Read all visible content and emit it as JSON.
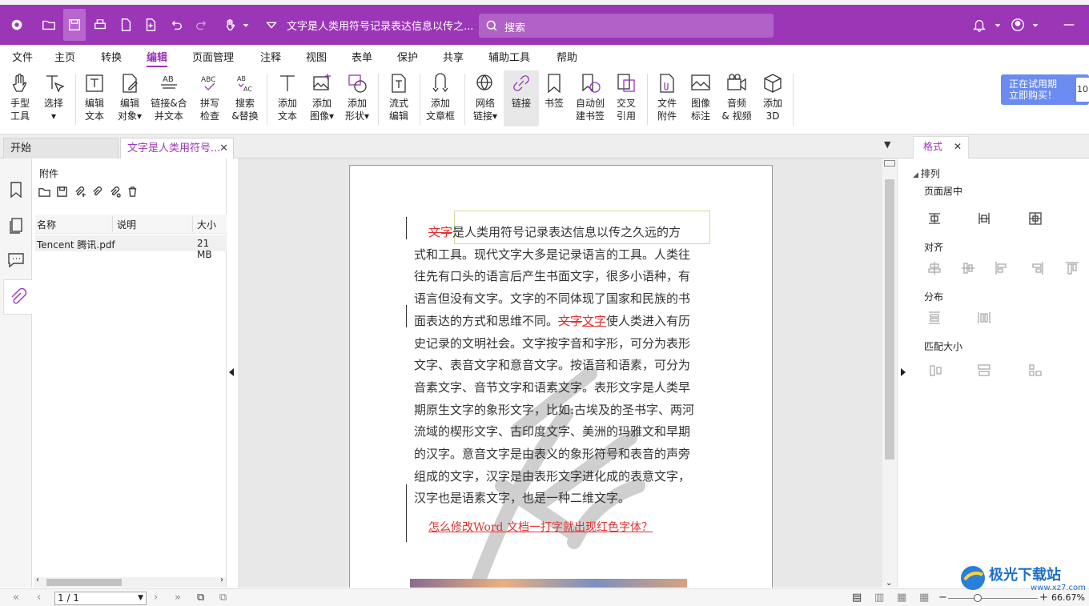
{
  "app": {
    "document_title": "文字是人类用符号记录表达信息以传之...",
    "search_placeholder": "搜索"
  },
  "menu": [
    "文件",
    "主页",
    "转换",
    "编辑",
    "页面管理",
    "注释",
    "视图",
    "表单",
    "保护",
    "共享",
    "辅助工具",
    "帮助"
  ],
  "ribbon": {
    "hand": [
      "手型",
      "工具"
    ],
    "select": [
      "选择",
      ""
    ],
    "edit_text": [
      "编辑",
      "文本"
    ],
    "edit_object": [
      "编辑",
      "对象"
    ],
    "link_merge": [
      "链接&合",
      "并文本"
    ],
    "spell": [
      "拼写",
      "检查"
    ],
    "search_replace": [
      "搜索",
      "&替换"
    ],
    "add_text": [
      "添加",
      "文本"
    ],
    "add_image": [
      "添加",
      "图像"
    ],
    "add_shape": [
      "添加",
      "形状"
    ],
    "flow_edit": [
      "流式",
      "编辑"
    ],
    "add_textbox": [
      "添加",
      "文章框"
    ],
    "web_link": [
      "网络",
      "链接"
    ],
    "link": [
      "链接",
      ""
    ],
    "bookmark": [
      "书签",
      ""
    ],
    "auto_bookmark": [
      "自动创",
      "建书签"
    ],
    "cross_ref": [
      "交叉",
      "引用"
    ],
    "file_attach": [
      "文件",
      "附件"
    ],
    "image_mark": [
      "图像",
      "标注"
    ],
    "audio_video": [
      "音频",
      "& 视频"
    ],
    "add_3d": [
      "添加",
      "3D"
    ],
    "trial": [
      "正在试用期",
      "立即购买！"
    ],
    "trial_side": "10"
  },
  "tabs": {
    "start": "开始",
    "doc": "文字是人类用符号...",
    "format": "格式"
  },
  "attachments": {
    "title": "附件",
    "columns": [
      "名称",
      "说明",
      "大小"
    ],
    "rows": [
      {
        "name": "Tencent 腾讯.pdf",
        "desc": "",
        "size": "21 MB"
      }
    ]
  },
  "document": {
    "lines": [
      "文字是人类用符号记录表达信息以传之久远的方",
      "式和工具。现代文字大多是记录语言的工具。人类往",
      "往先有口头的语言后产生书面文字，很多小语种，有",
      "语言但没有文字。文字的不同体现了国家和民族的书",
      "面表达的方式和思维不同。文字文字使人类进入有历",
      "史记录的文明社会。文字按字音和字形，可分为表形",
      "文字、表音文字和意音文字。按语音和语素，可分为",
      "音素文字、音节文字和语素文字。表形文字是人类早",
      "期原生文字的象形文字，比如:古埃及的圣书字、两河",
      "流域的楔形文字、古印度文字、美洲的玛雅文和早期",
      "的汉字。意音文字是由表义的象形符号和表音的声旁",
      "组成的文字，汉字是由表形文字进化成的表意文字，",
      "汉字也是语素文字，也是一种二维文字。"
    ],
    "strike_first": "文字",
    "first_rest": "是人类用符号记录表达信息以传之久远的方",
    "line5_pre": "面表达的方式和思维不同。",
    "line5_strike": "文字",
    "line5_under": "文字",
    "line5_post": "使人类进入有历",
    "red_question": "怎么修改Word 文档一打字就出现红色字体？"
  },
  "format_panel": {
    "arrange": "排列",
    "center": "页面居中",
    "align": "对齐",
    "distribute": "分布",
    "match_size": "匹配大小"
  },
  "status": {
    "page": "1 / 1",
    "zoom": "66.67%"
  },
  "watermark": {
    "text": "极光下载站",
    "url": "www.xz7.com"
  },
  "colors": {
    "brand": "#9b36b7",
    "red_text": "#e0312f"
  }
}
